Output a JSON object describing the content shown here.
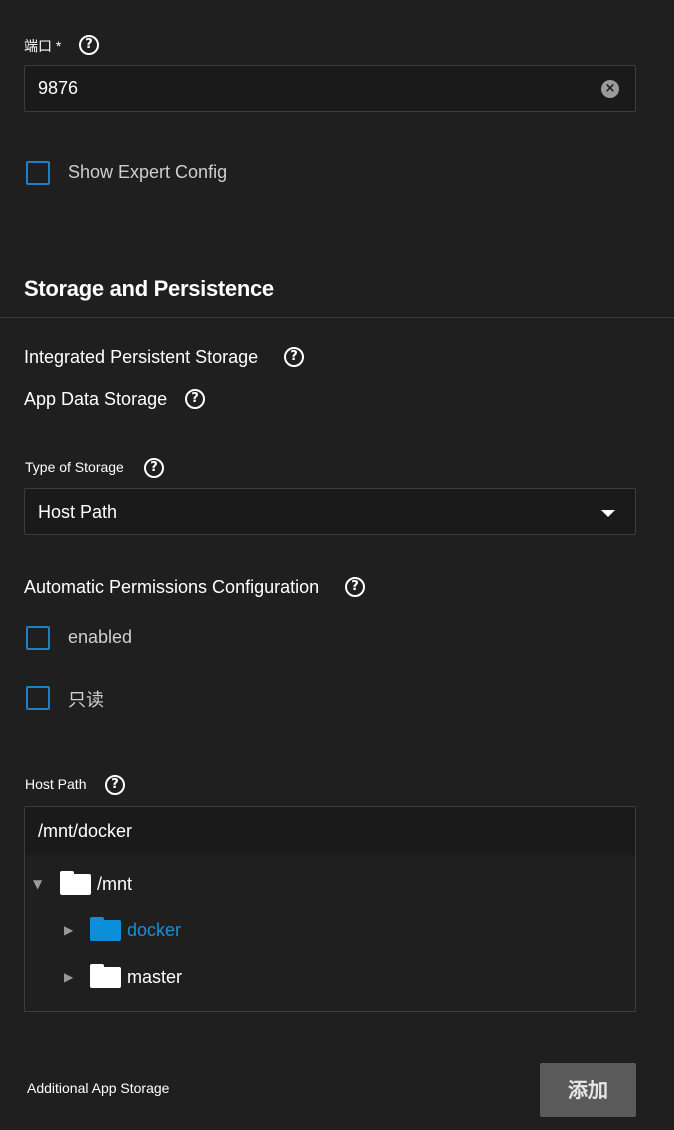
{
  "port": {
    "label": "端口",
    "required_marker": "*",
    "value": "9876",
    "clear_icon": "×"
  },
  "expert_config": {
    "label": "Show Expert Config",
    "checked": false
  },
  "storage_section": {
    "title": "Storage and Persistence",
    "integrated_label": "Integrated Persistent Storage",
    "app_data_label": "App Data Storage",
    "type_of_storage": {
      "label": "Type of Storage",
      "value": "Host Path"
    },
    "auto_permissions": {
      "label": "Automatic Permissions Configuration"
    },
    "enabled_checkbox": {
      "label": "enabled",
      "checked": false
    },
    "readonly_checkbox": {
      "label": "只读",
      "checked": false
    },
    "host_path": {
      "label": "Host Path",
      "value": "/mnt/docker"
    },
    "tree": {
      "root": {
        "label": "/mnt",
        "arrow": "▼"
      },
      "children": [
        {
          "label": "docker",
          "arrow": "▶",
          "selected": true
        },
        {
          "label": "master",
          "arrow": "▶",
          "selected": false
        }
      ]
    }
  },
  "additional_storage": {
    "label": "Additional App Storage",
    "add_button": "添加"
  },
  "icons": {
    "help": "?"
  },
  "colors": {
    "background": "#1f1f1f",
    "checkbox_border": "#1d7fc4",
    "selected_folder": "#0d8ed9",
    "selected_text": "#1a8fd8",
    "button_bg": "#5a5a5a"
  }
}
